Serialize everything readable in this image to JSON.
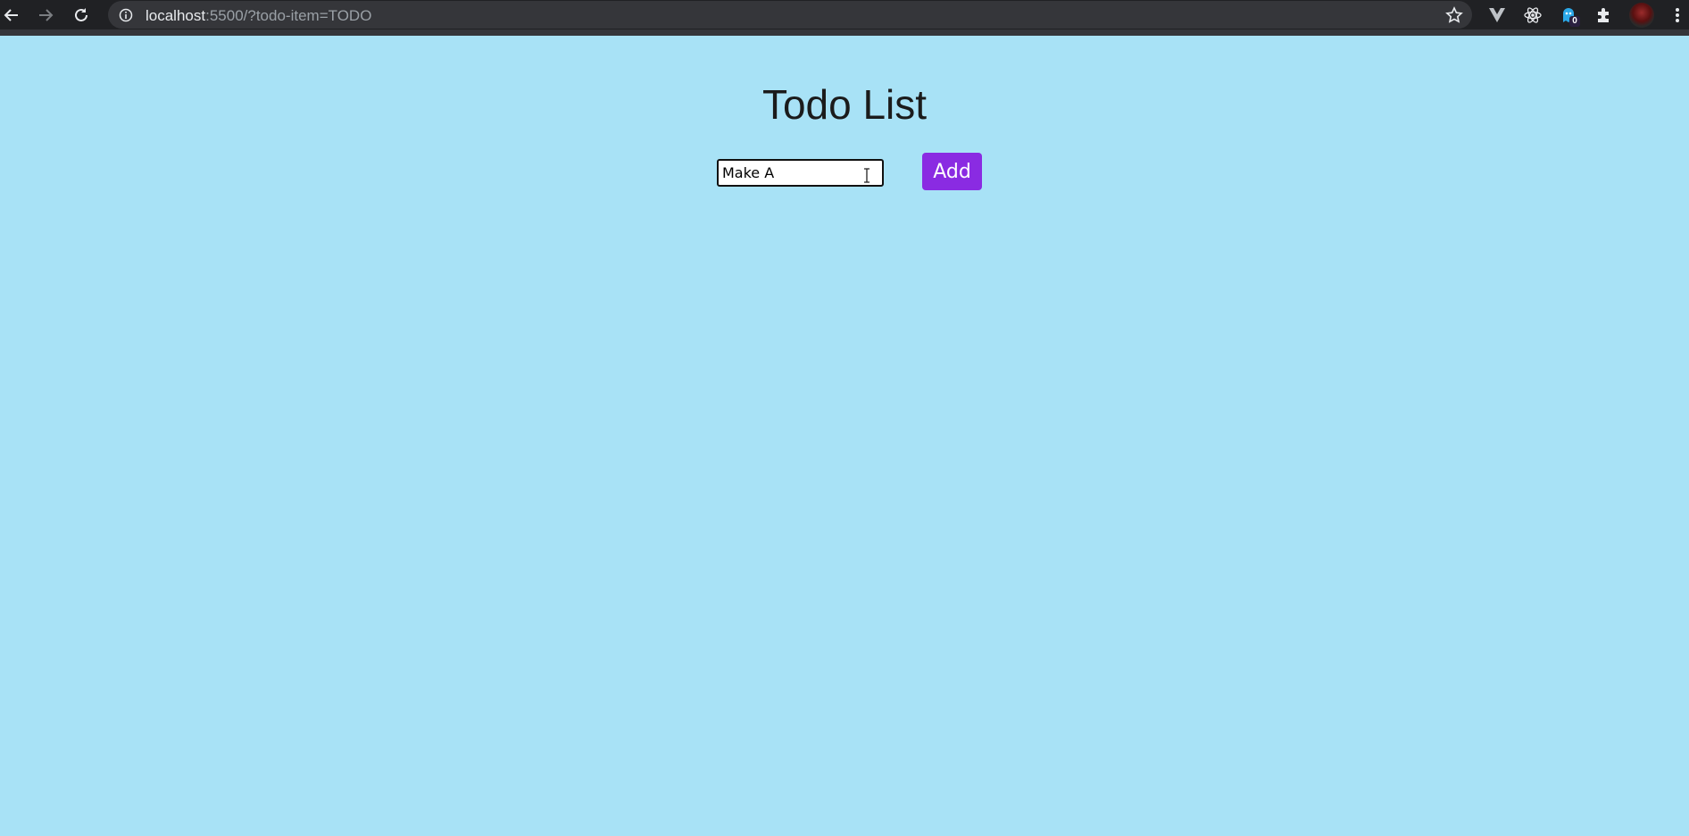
{
  "browser": {
    "url_host": "localhost",
    "url_rest": ":5500/?todo-item=TODO",
    "extension_badge": "0"
  },
  "page": {
    "title": "Todo List",
    "input_value": "Make A",
    "add_button_label": "Add"
  },
  "colors": {
    "background": "#a8e2f6",
    "button": "#8a2be2",
    "toolbar": "#202124"
  },
  "icons": [
    "back-arrow-icon",
    "forward-arrow-icon",
    "reload-icon",
    "info-icon",
    "star-icon",
    "vue-devtools-icon",
    "react-devtools-icon",
    "ghostery-icon",
    "extensions-puzzle-icon",
    "profile-avatar",
    "menu-kebab-icon",
    "text-cursor-icon"
  ]
}
